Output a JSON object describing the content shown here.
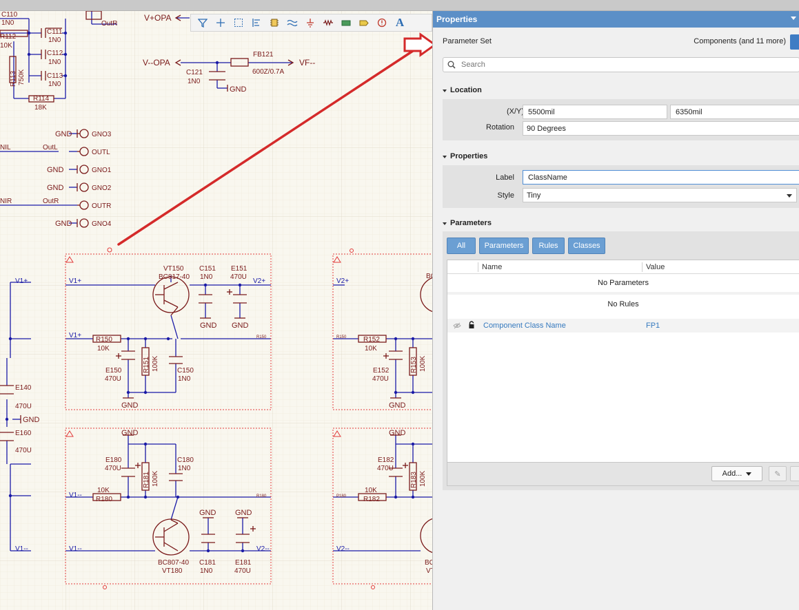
{
  "toolbar": {
    "buttons": [
      "filter-icon",
      "move-icon",
      "select-rect-icon",
      "align-icon",
      "component-icon",
      "wire-icon",
      "ground-icon",
      "resistor-icon",
      "port-icon",
      "sheet-entry-icon",
      "directive-icon",
      "text-icon"
    ],
    "text_glyph": "A"
  },
  "panel": {
    "title": "Properties",
    "parameter_set_label": "Parameter Set",
    "parameter_set_value": "Components (and 11 more)",
    "search_placeholder": "Search",
    "location": {
      "heading": "Location",
      "xy_label": "(X/Y)",
      "x_value": "5500mil",
      "y_value": "6350mil",
      "rotation_label": "Rotation",
      "rotation_value": "90 Degrees"
    },
    "properties": {
      "heading": "Properties",
      "label_label": "Label",
      "label_value": "ClassName",
      "style_label": "Style",
      "style_value": "Tiny"
    },
    "parameters": {
      "heading": "Parameters",
      "tabs": [
        "All",
        "Parameters",
        "Rules",
        "Classes"
      ],
      "col_name": "Name",
      "col_value": "Value",
      "no_parameters": "No Parameters",
      "no_rules": "No Rules",
      "rows": [
        {
          "name": "Component Class Name",
          "value": "FP1"
        }
      ],
      "add_label": "Add..."
    }
  },
  "schematic": {
    "labels": {
      "c110": "C110",
      "c110v": "1N0",
      "c111": "C111",
      "c111v": "1N0",
      "c112": "C112",
      "c112v": "1N0",
      "c113": "C113",
      "c113v": "1N0",
      "r112": "R112",
      "r112v": "10K",
      "r113": "R113",
      "r113v": "750K",
      "r114": "R114",
      "r114v": "18K",
      "outr_top": "OutR",
      "vplus_opa": "V+OPA",
      "vminus_opa": "V--OPA",
      "fb121": "FB121",
      "fb121v": "600Z/0.7A",
      "vf": "VF--",
      "c121": "C121",
      "c121v": "1N0",
      "gnd": "GND",
      "gno3": "GNO3",
      "outl": "OUTL",
      "gno1": "GNO1",
      "gno2": "GNO2",
      "outr": "OUTR",
      "gno4": "GNO4",
      "outl_net": "OutL",
      "outr_net": "OutR",
      "nil": "NIL",
      "nir": "NIR",
      "v1p": "V1+",
      "v2p": "V2+",
      "v1m": "V1--",
      "v2m": "V2--",
      "vt150": "VT150",
      "vt150v": "BC817-40",
      "c151": "C151",
      "c151v": "1N0",
      "e151": "E151",
      "e151v": "470U",
      "r150": "R150",
      "r150v": "10K",
      "r150net": "R150",
      "r151": "R151",
      "r151v": "100K",
      "e150": "E150",
      "e150v": "470U",
      "c150": "C150",
      "c150v": "1N0",
      "e140": "E140",
      "e140v": "470U",
      "e160": "E160",
      "e160v": "470U",
      "r152": "R152",
      "r152v": "10K",
      "r152net": "R150",
      "r153": "R153",
      "r153v": "100K",
      "e152": "E152",
      "e152v": "470U",
      "e180": "E180",
      "e180v": "470U",
      "r181": "R181",
      "r181v": "100K",
      "c180": "C180",
      "c180v": "1N0",
      "r180": "R180",
      "r180v": "10K",
      "r180net": "R180",
      "vt180": "VT180",
      "vt180v": "BC807-40",
      "c181": "C181",
      "c181v": "1N0",
      "e181": "E181",
      "e181v": "470U",
      "e182": "E182",
      "e182v": "470U",
      "r183": "R183",
      "r183v": "100K",
      "r182": "R182",
      "r182v": "10K",
      "r182net": "P180",
      "bc_partial": "BC",
      "vt_partial": "VT"
    }
  },
  "colors": {
    "wire": "#1a1aa6",
    "part": "#7a1a1a",
    "panel_header": "#5b8fc7",
    "annotation_arrow": "#d42a2a",
    "link": "#3579be"
  }
}
